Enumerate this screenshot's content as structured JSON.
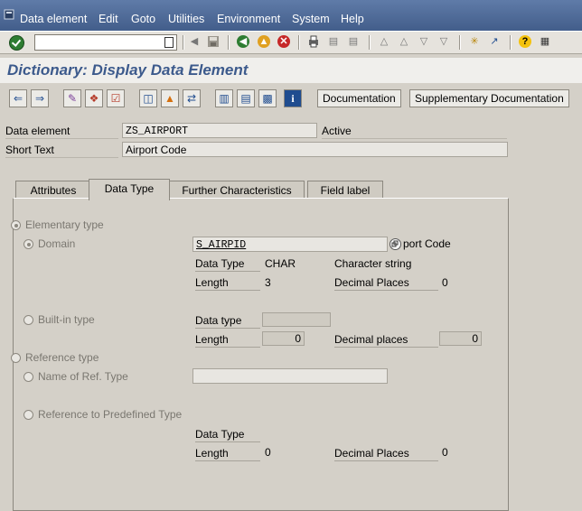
{
  "menu": {
    "items": [
      "Data element",
      "Edit",
      "Goto",
      "Utilities",
      "Environment",
      "System",
      "Help"
    ]
  },
  "command_field": {
    "value": ""
  },
  "page": {
    "title": "Dictionary: Display Data Element"
  },
  "app_toolbar": {
    "documentation": "Documentation",
    "supplementary_documentation": "Supplementary Documentation"
  },
  "header": {
    "data_element_label": "Data element",
    "data_element_value": "ZS_AIRPORT",
    "status": "Active",
    "short_text_label": "Short Text",
    "short_text_value": "Airport Code"
  },
  "tabs": [
    "Attributes",
    "Data Type",
    "Further Characteristics",
    "Field label"
  ],
  "active_tab": "Data Type",
  "data_type_tab": {
    "elementary_type": "Elementary type",
    "domain_label": "Domain",
    "domain_value": "S_AIRPID",
    "domain_short_text": "port Code",
    "dt_label": "Data Type",
    "dt_value": "CHAR",
    "dt_desc": "Character string",
    "length_label": "Length",
    "length_value": "3",
    "decimal_label": "Decimal Places",
    "decimal_value": "0",
    "builtin_type": "Built-in type",
    "builtin_dt_label": "Data type",
    "builtin_length_label": "Length",
    "builtin_length_value": "0",
    "builtin_decimal_label": "Decimal places",
    "builtin_decimal_value": "0",
    "reference_type": "Reference type",
    "name_of_ref_type": "Name of Ref. Type",
    "ref_predefined": "Reference to Predefined Type",
    "ref_dt_label": "Data Type",
    "ref_length_label": "Length",
    "ref_length_value": "0",
    "ref_decimal_label": "Decimal Places",
    "ref_decimal_value": "0"
  },
  "colors": {
    "menubar": "#4a6694",
    "title": "#3c5a8c",
    "background": "#d4d0c8"
  }
}
